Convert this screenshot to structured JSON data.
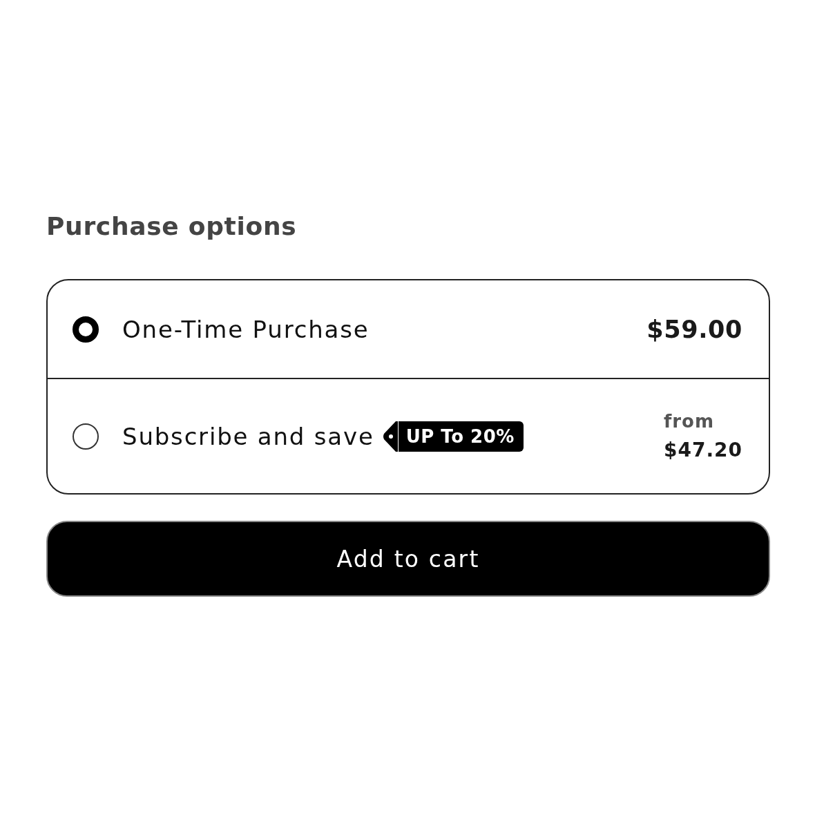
{
  "heading": "Purchase options",
  "options": [
    {
      "label": "One-Time Purchase",
      "selected": true,
      "price": "$59.00"
    },
    {
      "label": "Subscribe and save",
      "selected": false,
      "badge": "UP To 20%",
      "price_prefix": "from",
      "price": "$47.20"
    }
  ],
  "button": {
    "label": "Add to cart"
  }
}
